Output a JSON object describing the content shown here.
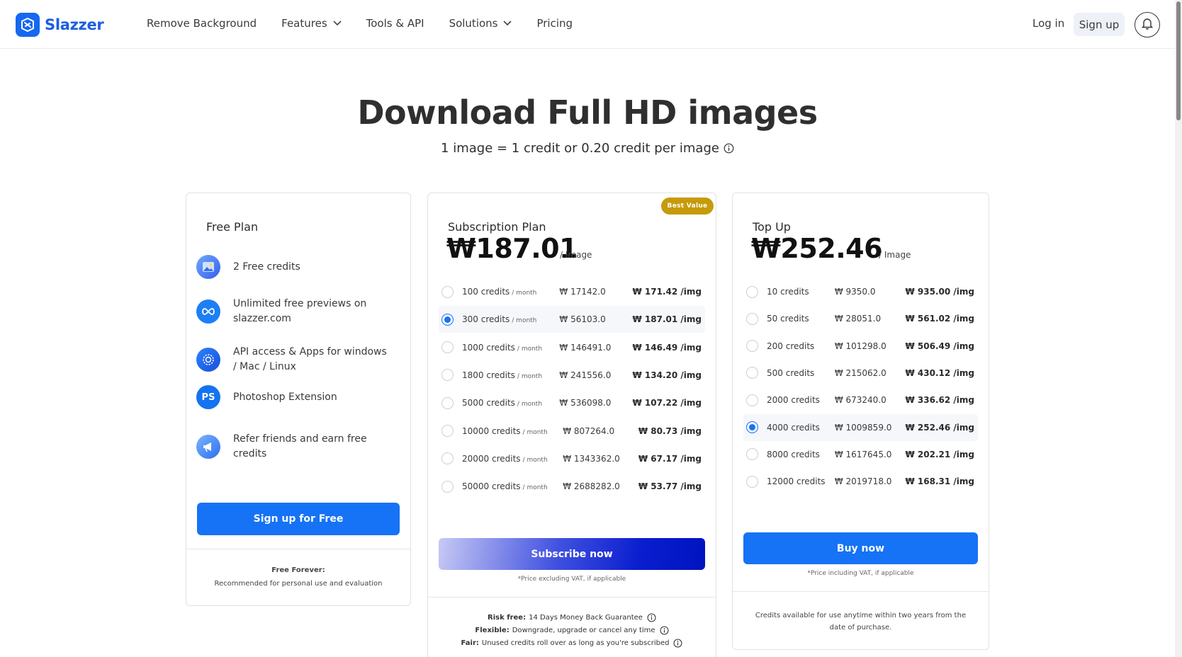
{
  "brand": {
    "name": "Slazzer",
    "color": "#1668f0"
  },
  "nav": {
    "items": [
      {
        "label": "Remove Background",
        "dropdown": false
      },
      {
        "label": "Features",
        "dropdown": true
      },
      {
        "label": "Tools & API",
        "dropdown": false
      },
      {
        "label": "Solutions",
        "dropdown": true
      },
      {
        "label": "Pricing",
        "dropdown": false
      }
    ],
    "login": "Log in",
    "signup": "Sign up",
    "bell_icon": "bell-icon"
  },
  "hero": {
    "title": "Download Full HD images",
    "subtitle": "1 image = 1 credit or 0.20 credit per image"
  },
  "free_plan": {
    "name": "Free Plan",
    "features": [
      {
        "icon": "image-icon",
        "text": "2 Free credits"
      },
      {
        "icon": "infinity-icon",
        "text": "Unlimited free previews on slazzer.com"
      },
      {
        "icon": "api-gear-icon",
        "text": "API access & Apps for windows / Mac / Linux"
      },
      {
        "icon": "photoshop-icon",
        "text": "Photoshop Extension",
        "glyph": "PS"
      },
      {
        "icon": "megaphone-icon",
        "text": "Refer friends and earn free credits"
      }
    ],
    "button": "Sign up for Free",
    "footer_title": "Free Forever:",
    "footer_text": "Recommended for personal use and evaluation"
  },
  "subscription_plan": {
    "name": "Subscription Plan",
    "badge": "Best Value",
    "price": "₩187.01",
    "per_image": "/ Image",
    "unit": "/ month",
    "selected_index": 1,
    "rows": [
      {
        "credits": "100 credits",
        "total": "₩ 17142.0",
        "per_img": "₩ 171.42 /img"
      },
      {
        "credits": "300 credits",
        "total": "₩ 56103.0",
        "per_img": "₩ 187.01 /img"
      },
      {
        "credits": "1000 credits",
        "total": "₩ 146491.0",
        "per_img": "₩ 146.49 /img"
      },
      {
        "credits": "1800 credits",
        "total": "₩ 241556.0",
        "per_img": "₩ 134.20 /img"
      },
      {
        "credits": "5000 credits",
        "total": "₩ 536098.0",
        "per_img": "₩ 107.22 /img"
      },
      {
        "credits": "10000 credits",
        "total": "₩ 807264.0",
        "per_img": "₩ 80.73 /img"
      },
      {
        "credits": "20000 credits",
        "total": "₩ 1343362.0",
        "per_img": "₩ 67.17 /img"
      },
      {
        "credits": "50000 credits",
        "total": "₩ 2688282.0",
        "per_img": "₩ 53.77 /img"
      }
    ],
    "button": "Subscribe now",
    "vat_note": "*Price excluding VAT, if applicable",
    "terms": [
      {
        "label": "Risk free:",
        "text": "14 Days Money Back Guarantee"
      },
      {
        "label": "Flexible:",
        "text": "Downgrade, upgrade or cancel any time"
      },
      {
        "label": "Fair:",
        "text": "Unused credits roll over as long as you're subscribed"
      }
    ]
  },
  "topup_plan": {
    "name": "Top Up",
    "price": "₩252.46",
    "per_image": "/ Image",
    "selected_index": 5,
    "rows": [
      {
        "credits": "10 credits",
        "total": "₩ 9350.0",
        "per_img": "₩ 935.00 /img"
      },
      {
        "credits": "50 credits",
        "total": "₩ 28051.0",
        "per_img": "₩ 561.02 /img"
      },
      {
        "credits": "200 credits",
        "total": "₩ 101298.0",
        "per_img": "₩ 506.49 /img"
      },
      {
        "credits": "500 credits",
        "total": "₩ 215062.0",
        "per_img": "₩ 430.12 /img"
      },
      {
        "credits": "2000 credits",
        "total": "₩ 673240.0",
        "per_img": "₩ 336.62 /img"
      },
      {
        "credits": "4000 credits",
        "total": "₩ 1009859.0",
        "per_img": "₩ 252.46 /img"
      },
      {
        "credits": "8000 credits",
        "total": "₩ 1617645.0",
        "per_img": "₩ 202.21 /img"
      },
      {
        "credits": "12000 credits",
        "total": "₩ 2019718.0",
        "per_img": "₩ 168.31 /img"
      }
    ],
    "button": "Buy now",
    "vat_note": "*Price including VAT, if applicable",
    "footer_text": "Credits available for use anytime within two years from the date of purchase."
  }
}
